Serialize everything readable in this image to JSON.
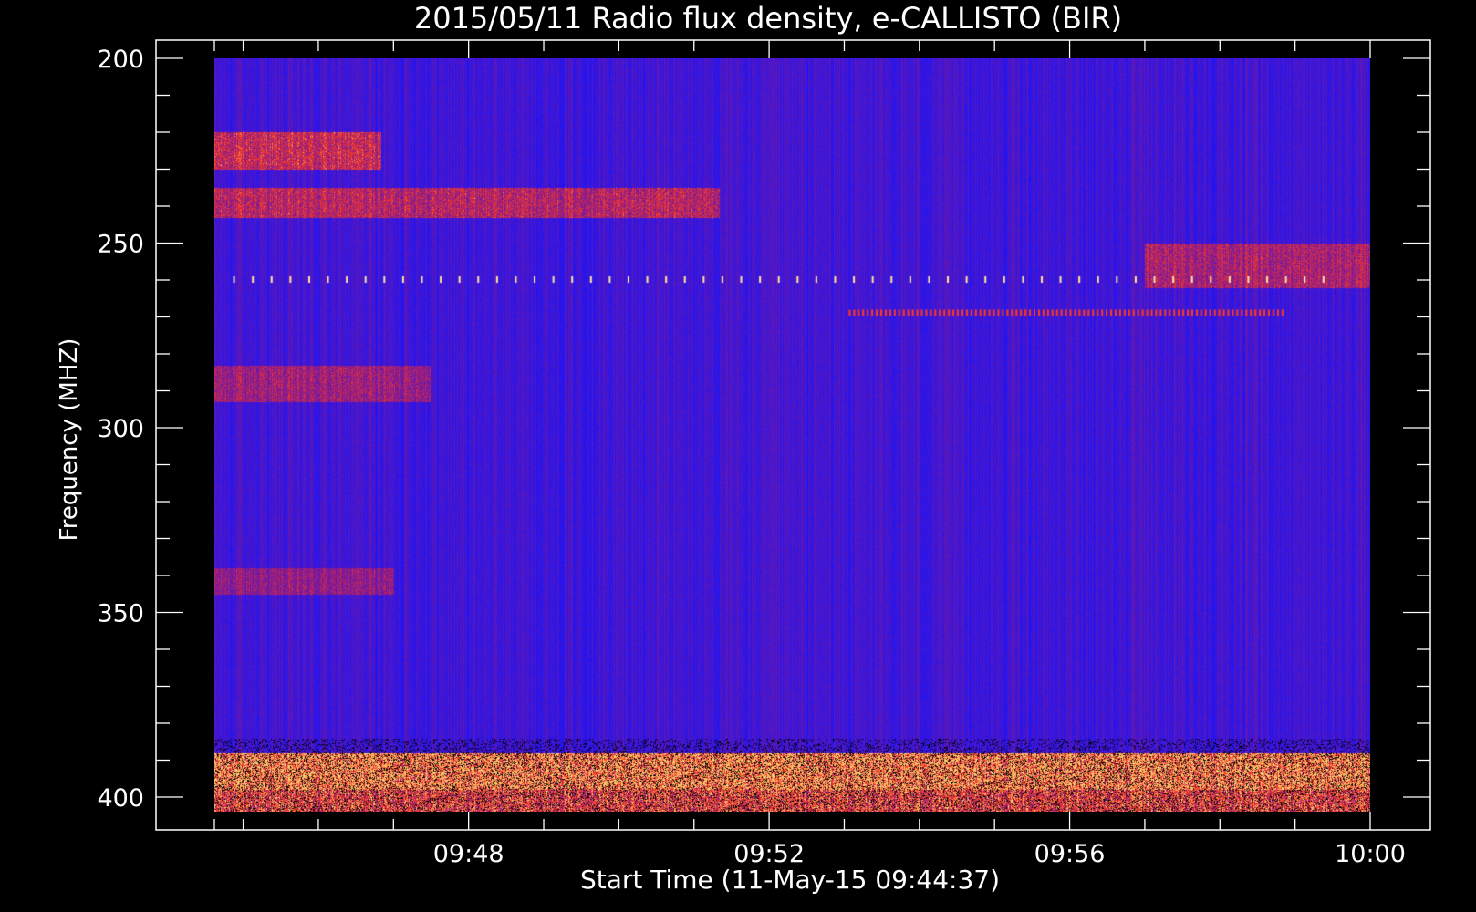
{
  "chart_data": {
    "type": "heatmap",
    "title": "2015/05/11  Radio flux density, e-CALLISTO (BIR)",
    "xlabel": "Start Time (11-May-15 09:44:37)",
    "ylabel": "Frequency (MHZ)",
    "y_axis": {
      "range": [
        200,
        405
      ],
      "inverted": true,
      "major_ticks": [
        200,
        250,
        300,
        350,
        400
      ],
      "tick_labels": [
        "200",
        "250",
        "300",
        "350",
        "400"
      ],
      "minor_step": 10
    },
    "x_axis": {
      "range": [
        "09:44:37",
        "10:00:00"
      ],
      "major_ticks": [
        "09:48",
        "09:52",
        "09:56",
        "10:00"
      ],
      "tick_labels": [
        "09:48",
        "09:52",
        "09:56",
        "10:00"
      ],
      "minor_step_minutes": 1
    },
    "colors": {
      "background": "#000000",
      "frame": "#ffffff",
      "low": "#1414ff",
      "mid": "#8a1a8c",
      "high": "#ff3b1e",
      "peak": "#ffd070"
    },
    "features": [
      {
        "kind": "band",
        "freq_range": [
          220,
          230
        ],
        "time_range": [
          "09:44:37",
          "09:46:50"
        ],
        "intensity": 0.55
      },
      {
        "kind": "band",
        "freq_range": [
          235,
          243
        ],
        "time_range": [
          "09:44:37",
          "09:51:20"
        ],
        "intensity": 0.5
      },
      {
        "kind": "band",
        "freq_range": [
          250,
          262
        ],
        "time_range": [
          "09:57:00",
          "10:00:00"
        ],
        "intensity": 0.45
      },
      {
        "kind": "band",
        "freq_range": [
          283,
          293
        ],
        "time_range": [
          "09:44:37",
          "09:47:30"
        ],
        "intensity": 0.4
      },
      {
        "kind": "band",
        "freq_range": [
          338,
          345
        ],
        "time_range": [
          "09:44:37",
          "09:47:00"
        ],
        "intensity": 0.35
      },
      {
        "kind": "band",
        "freq_range": [
          388,
          398
        ],
        "time_range": [
          "09:44:37",
          "10:00:00"
        ],
        "intensity": 0.9
      },
      {
        "kind": "band",
        "freq_range": [
          398,
          405
        ],
        "time_range": [
          "09:44:37",
          "10:00:00"
        ],
        "intensity": 0.7
      },
      {
        "kind": "dots",
        "freq": 260,
        "time_range": [
          "09:44:37",
          "09:59:30"
        ],
        "spacing_minutes": 0.25,
        "intensity": 1.0
      },
      {
        "kind": "dots",
        "freq": 269,
        "time_range": [
          "09:53:00",
          "09:58:50"
        ],
        "spacing_minutes": 0.06,
        "intensity": 0.8
      }
    ]
  }
}
